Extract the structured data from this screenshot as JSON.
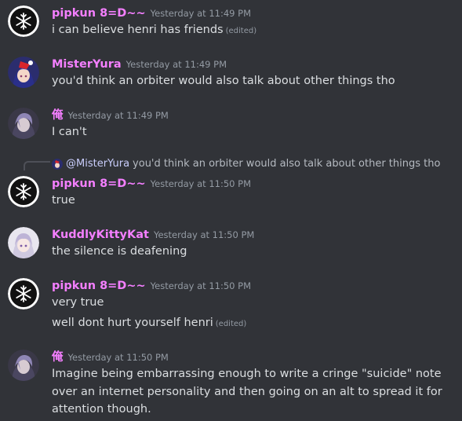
{
  "messages": [
    {
      "username": "pipkun 8=D~~",
      "timestamp": "Yesterday at 11:49 PM",
      "avatar": "snowflake-avatar",
      "lines": [
        {
          "text": "i can believe henri has friends",
          "edited": "(edited)"
        }
      ]
    },
    {
      "username": "MisterYura",
      "timestamp": "Yesterday at 11:49 PM",
      "avatar": "anime-girl-santa-hat-avatar",
      "lines": [
        {
          "text": "you'd think an orbiter would also talk about other things tho"
        }
      ]
    },
    {
      "username": "俺",
      "timestamp": "Yesterday at 11:49 PM",
      "avatar": "purple-hair-avatar",
      "lines": [
        {
          "text": "I can't"
        }
      ]
    },
    {
      "reply": {
        "mention": "@MisterYura",
        "text": "you'd think an orbiter would also talk about other things tho"
      },
      "username": "pipkun 8=D~~",
      "timestamp": "Yesterday at 11:50 PM",
      "avatar": "snowflake-avatar",
      "lines": [
        {
          "text": "true"
        }
      ]
    },
    {
      "username": "KuddlyKittyKat",
      "timestamp": "Yesterday at 11:50 PM",
      "avatar": "white-hair-anime-avatar",
      "lines": [
        {
          "text": "the silence is deafening"
        }
      ]
    },
    {
      "username": "pipkun 8=D~~",
      "timestamp": "Yesterday at 11:50 PM",
      "avatar": "snowflake-avatar",
      "lines": [
        {
          "text": "very true"
        },
        {
          "text": "well dont hurt yourself henri",
          "edited": "(edited)"
        }
      ]
    },
    {
      "username": "俺",
      "timestamp": "Yesterday at 11:50 PM",
      "avatar": "purple-hair-avatar",
      "lines": [
        {
          "text": "Imagine being embarrassing enough to write a cringe \"suicide\" note over an internet personality and then going on an alt to spread it for attention though."
        }
      ]
    }
  ],
  "colors": {
    "background": "#313338",
    "username": "#f47fff",
    "timestamp": "#949ba4",
    "text": "#dbdee1",
    "mention": "#c9cdfb"
  }
}
